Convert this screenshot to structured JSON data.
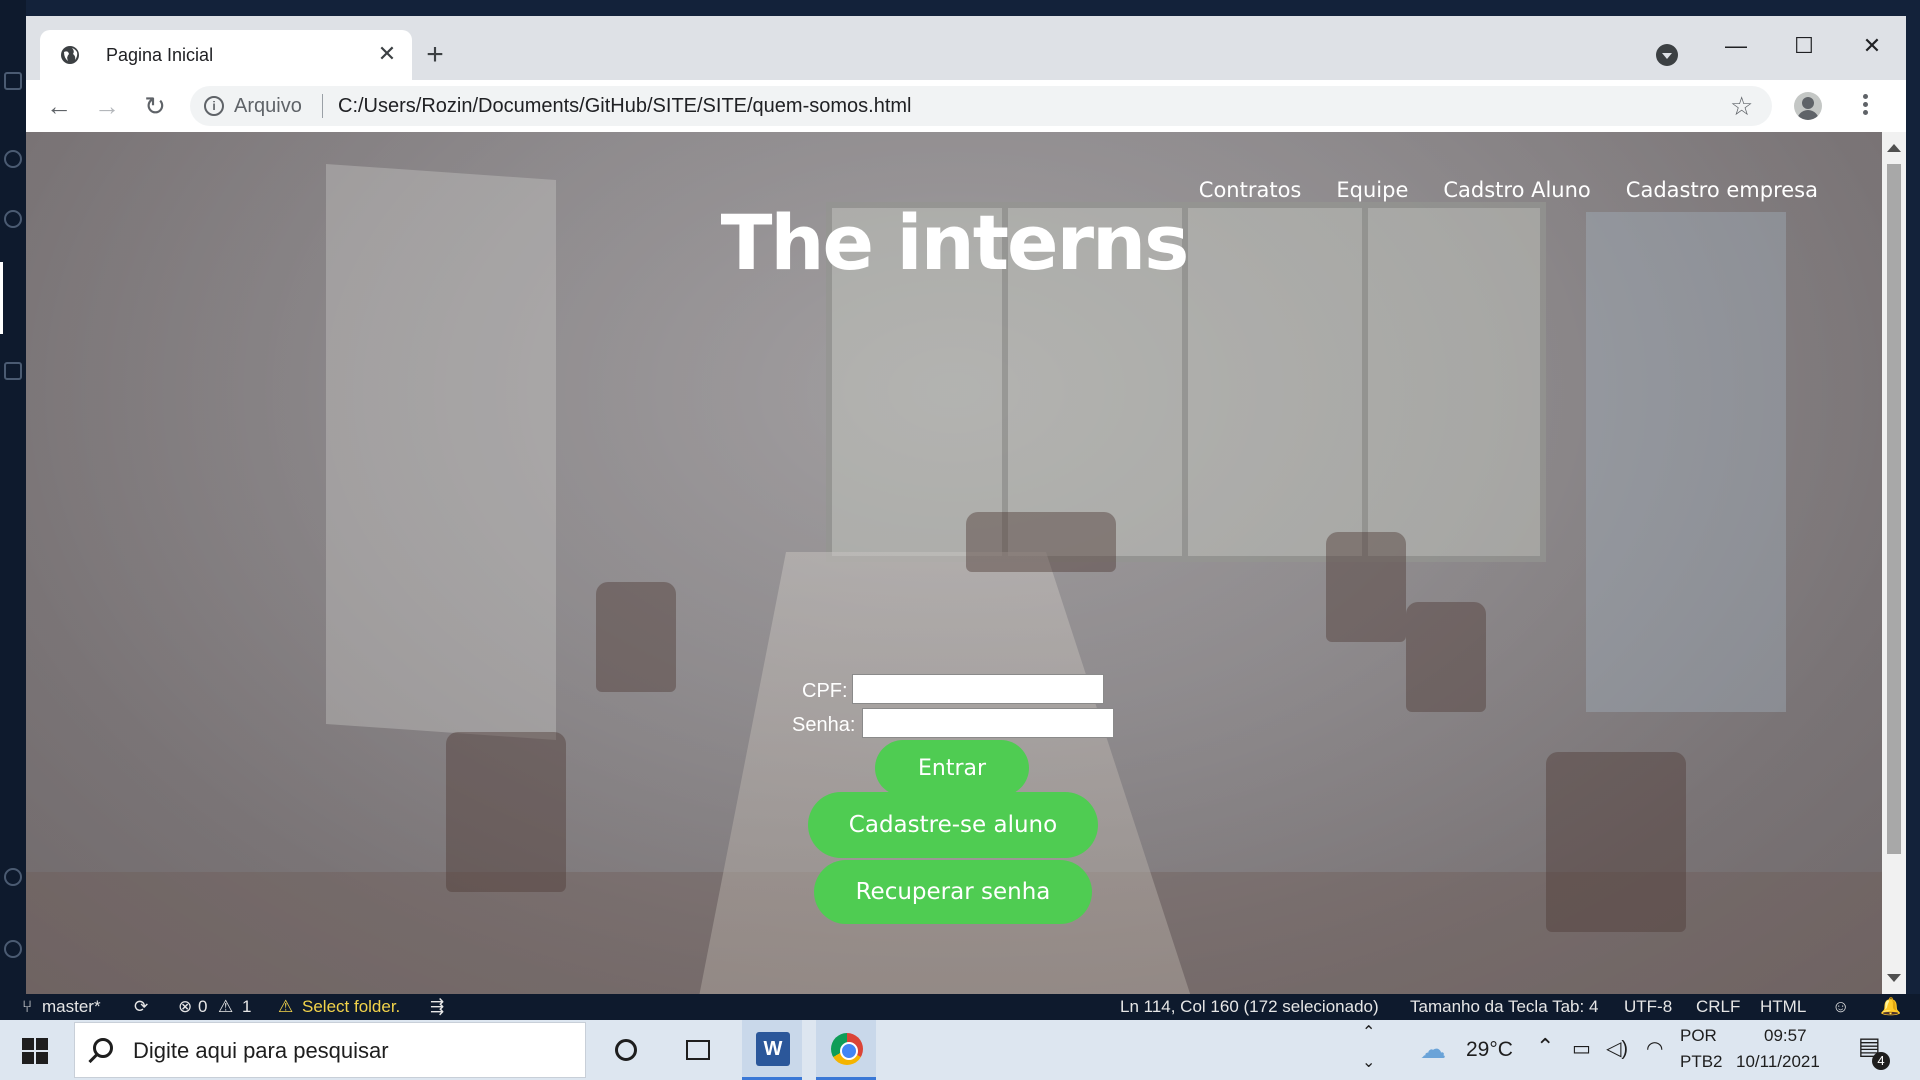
{
  "browser": {
    "tab_title": "Pagina Inicial",
    "new_tab_label": "+",
    "close_tab_label": "✕",
    "address_scheme": "Arquivo",
    "address_url": "C:/Users/Rozin/Documents/GitHub/SITE/SITE/quem-somos.html",
    "window_minimize": "—",
    "window_maximize": "☐",
    "window_close": "✕"
  },
  "site": {
    "nav": [
      "Contratos",
      "Equipe",
      "Cadstro Aluno",
      "Cadastro empresa"
    ],
    "title": "The interns",
    "login": {
      "cpf_label": "CPF:",
      "cpf_value": "",
      "senha_label": "Senha:",
      "senha_value": "",
      "entrar": "Entrar",
      "cadastre": "Cadastre-se aluno",
      "recuperar": "Recuperar senha"
    }
  },
  "statusbar": {
    "branch": "master*",
    "errors": "0",
    "warnings": "1",
    "folder_warning": "Select folder.",
    "cursor": "Ln 114, Col 160 (172 selecionado)",
    "tab_size": "Tamanho da Tecla Tab: 4",
    "encoding": "UTF-8",
    "eol": "CRLF",
    "language": "HTML"
  },
  "taskbar": {
    "search_placeholder": "Digite aqui para pesquisar",
    "temperature": "29°C",
    "language": "POR",
    "layout": "PTB2",
    "time": "09:57",
    "date": "10/11/2021",
    "notifications": "4"
  }
}
